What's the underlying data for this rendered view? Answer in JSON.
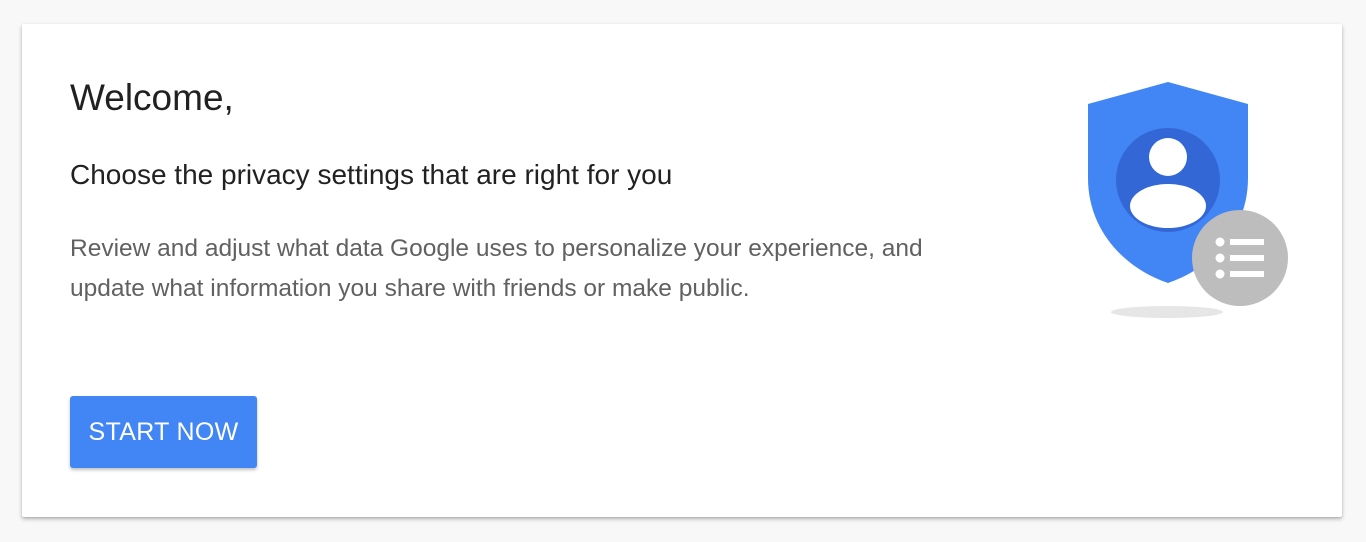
{
  "welcome": {
    "heading": "Welcome,",
    "subheading": "Choose the privacy settings that are right for you",
    "description": "Review and adjust what data Google uses to personalize your experience, and update what information you share with friends or make public.",
    "start_button_label": "START NOW"
  },
  "illustration": {
    "icons": [
      "shield-icon",
      "person-icon",
      "list-icon"
    ],
    "colors": {
      "shield": "#4285f4",
      "shield_inner": "#3367d6",
      "person": "#ffffff",
      "list_badge": "#bdbdbd",
      "shadow": "#e6e6e6"
    }
  },
  "colors": {
    "accent": "#4285f4",
    "heading_text": "#212121",
    "body_text": "#616161",
    "background": "#f8f8f8",
    "card": "#ffffff"
  }
}
